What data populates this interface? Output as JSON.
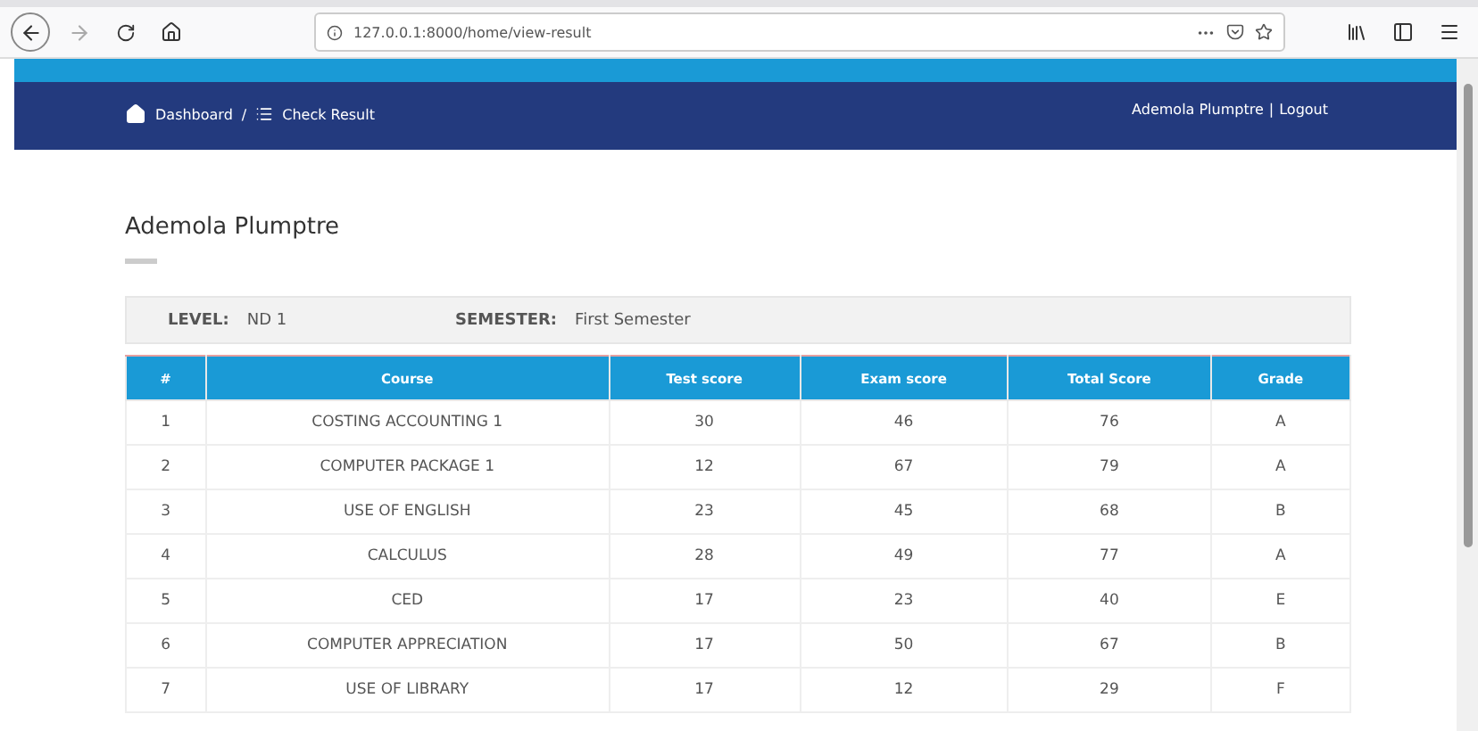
{
  "browser": {
    "url": "127.0.0.1:8000/home/view-result"
  },
  "nav": {
    "breadcrumbs": [
      {
        "label": "Dashboard"
      },
      {
        "label": "Check Result"
      }
    ],
    "separator": "/",
    "user": "Ademola Plumptre",
    "divider": "|",
    "logout": "Logout"
  },
  "student": {
    "name": "Ademola Plumptre"
  },
  "info": [
    {
      "label": "LEVEL:",
      "value": "ND 1"
    },
    {
      "label": "SEMESTER:",
      "value": "First Semester"
    }
  ],
  "table": {
    "columns": [
      "#",
      "Course",
      "Test score",
      "Exam score",
      "Total Score",
      "Grade"
    ],
    "rows": [
      [
        "1",
        "COSTING ACCOUNTING 1",
        "30",
        "46",
        "76",
        "A"
      ],
      [
        "2",
        "COMPUTER PACKAGE 1",
        "12",
        "67",
        "79",
        "A"
      ],
      [
        "3",
        "USE OF ENGLISH",
        "23",
        "45",
        "68",
        "B"
      ],
      [
        "4",
        "CALCULUS",
        "28",
        "49",
        "77",
        "A"
      ],
      [
        "5",
        "CED",
        "17",
        "23",
        "40",
        "E"
      ],
      [
        "6",
        "COMPUTER APPRECIATION",
        "17",
        "50",
        "67",
        "B"
      ],
      [
        "7",
        "USE OF LIBRARY",
        "17",
        "12",
        "29",
        "F"
      ]
    ]
  }
}
